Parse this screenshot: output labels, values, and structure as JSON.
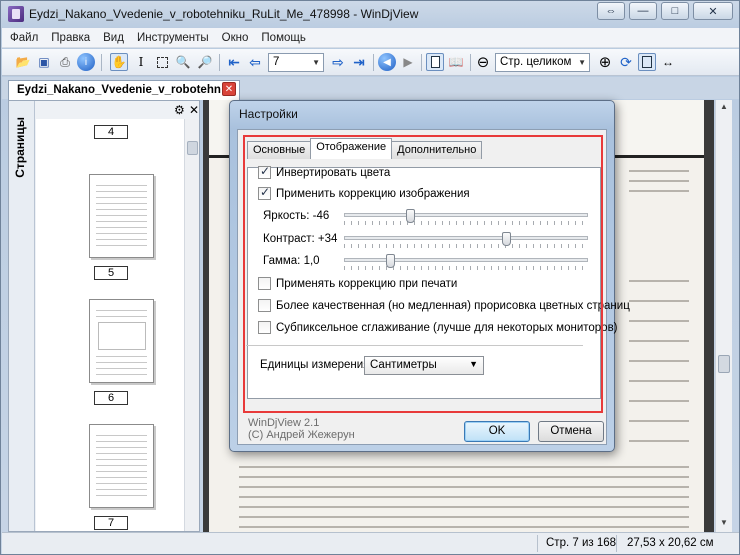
{
  "window": {
    "title": "Eydzi_Nakano_Vvedenie_v_robotehniku_RuLit_Me_478998 - WinDjView",
    "controls": {
      "restore": "⇔",
      "minimize": "—",
      "maximize": "□",
      "close": "✕"
    }
  },
  "menu": [
    "Файл",
    "Правка",
    "Вид",
    "Инструменты",
    "Окно",
    "Помощь"
  ],
  "toolbar": {
    "page_value": "7",
    "zoom_value": "Стр. целиком",
    "icons": [
      "open-icon",
      "save-icon",
      "print-icon",
      "info-icon",
      "hand-icon",
      "text-select-icon",
      "rect-select-icon",
      "zoom-icon",
      "zoom-rect-icon",
      "first-page-icon",
      "prev-page-icon",
      "next-page-icon",
      "last-page-icon",
      "back-icon",
      "forward-icon",
      "single-page-icon",
      "two-page-icon",
      "zoom-out-icon",
      "zoom-in-icon",
      "rotate-icon",
      "fit-page-icon",
      "fit-width-icon"
    ]
  },
  "tab": {
    "label": "Eydzi_Nakano_Vvedenie_v_robotehn",
    "close": "✕"
  },
  "sidebar": {
    "label": "Страницы",
    "pages": [
      "4",
      "5",
      "6",
      "7"
    ]
  },
  "status": {
    "page": "Стр. 7 из 168",
    "size": "27,53 x 20,62 см"
  },
  "dialog": {
    "title": "Настройки",
    "tabs": [
      "Основные",
      "Отображение",
      "Дополнительно"
    ],
    "active_tab": "Отображение",
    "checkboxes": {
      "invert": {
        "label": "Инвертировать цвета",
        "checked": true
      },
      "correction": {
        "label": "Применить коррекцию изображения",
        "checked": true
      },
      "print_correction": {
        "label": "Применять коррекцию при печати",
        "checked": false
      },
      "hq_color": {
        "label": "Более качественная (но медленная) прорисовка цветных страниц",
        "checked": false
      },
      "subpixel": {
        "label": "Субпиксельное сглаживание (лучше для некоторых мониторов)",
        "checked": false
      }
    },
    "sliders": {
      "brightness": {
        "label": "Яркость: -46",
        "value": -46,
        "range": [
          -100,
          100
        ]
      },
      "contrast": {
        "label": "Контраст: +34",
        "value": 34,
        "range": [
          -100,
          100
        ]
      },
      "gamma": {
        "label": "Гамма: 1,0",
        "value": 1.0,
        "range": [
          0.1,
          5.0
        ]
      }
    },
    "units": {
      "label": "Единицы измерения:",
      "value": "Сантиметры"
    },
    "version": "WinDjView 2.1",
    "copyright": "(C) Андрей Жежерун",
    "ok": "OK",
    "cancel": "Отмена",
    "highlight_color": "#e83a3a"
  }
}
